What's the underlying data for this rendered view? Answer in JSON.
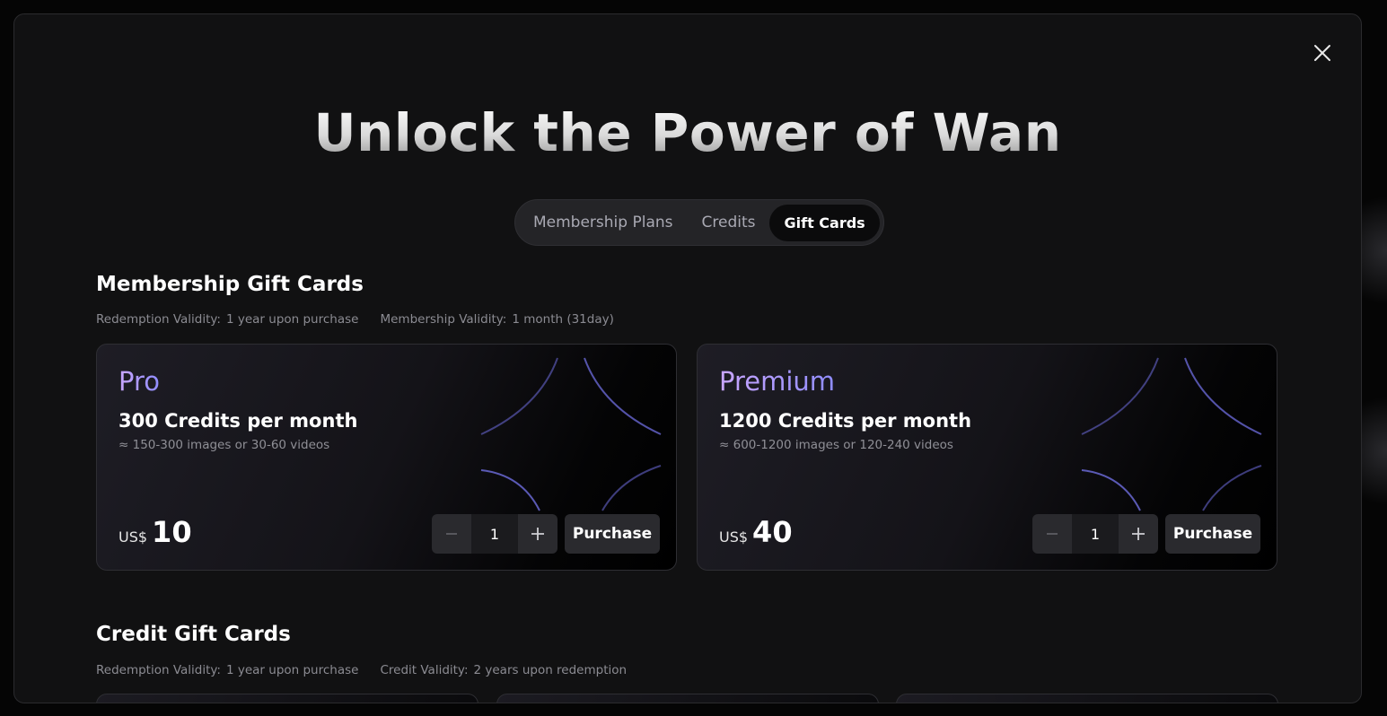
{
  "modal": {
    "title": "Unlock the Power of Wan",
    "close_icon": "close-icon"
  },
  "tabs": [
    {
      "label": "Membership Plans",
      "active": false
    },
    {
      "label": "Credits",
      "active": false
    },
    {
      "label": "Gift Cards",
      "active": true
    }
  ],
  "membership_section": {
    "title": "Membership Gift Cards",
    "redemption_label": "Redemption Validity:",
    "redemption_value": "1 year upon purchase",
    "validity_label": "Membership Validity:",
    "validity_value": "1 month (31day)",
    "cards": [
      {
        "tier": "Pro",
        "credits": "300 Credits per month",
        "approx": "≈ 150-300 images or 30-60 videos",
        "currency": "US$",
        "price": "10",
        "quantity": "1",
        "purchase_label": "Purchase"
      },
      {
        "tier": "Premium",
        "credits": "1200 Credits per month",
        "approx": "≈ 600-1200 images or 120-240 videos",
        "currency": "US$",
        "price": "40",
        "quantity": "1",
        "purchase_label": "Purchase"
      }
    ]
  },
  "credit_section": {
    "title": "Credit Gift Cards",
    "redemption_label": "Redemption Validity:",
    "redemption_value": "1 year upon purchase",
    "validity_label": "Credit Validity:",
    "validity_value": "2 years upon redemption"
  },
  "colors": {
    "modal_bg": "#111112",
    "tier_gradient_start": "#c9a6ff",
    "tier_gradient_end": "#8f8cff",
    "deco_arc": "#6f6ee0"
  }
}
